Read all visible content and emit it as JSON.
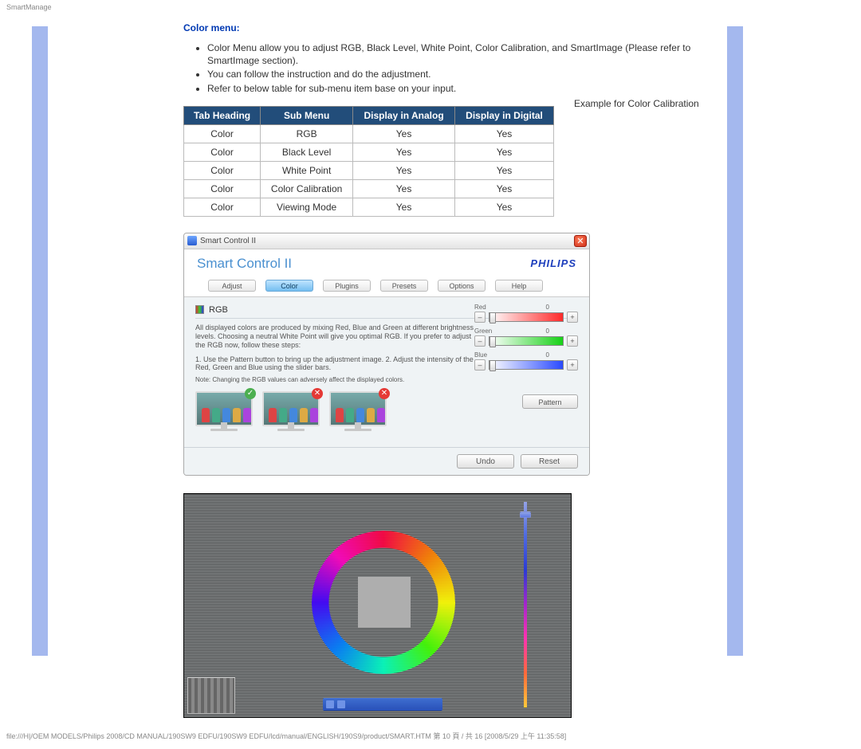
{
  "page_header": "SmartManage",
  "section_title": "Color menu:",
  "bullets": [
    "Color Menu allow you to adjust RGB, Black Level, White Point, Color Calibration, and SmartImage (Please refer to SmartImage section).",
    "You can follow the instruction and do the adjustment.",
    "Refer to below table for sub-menu item base on your input."
  ],
  "example_text": "Example for Color Calibration",
  "table": {
    "headers": [
      "Tab Heading",
      "Sub Menu",
      "Display in Analog",
      "Display in Digital"
    ],
    "rows": [
      [
        "Color",
        "RGB",
        "Yes",
        "Yes"
      ],
      [
        "Color",
        "Black Level",
        "Yes",
        "Yes"
      ],
      [
        "Color",
        "White Point",
        "Yes",
        "Yes"
      ],
      [
        "Color",
        "Color Calibration",
        "Yes",
        "Yes"
      ],
      [
        "Color",
        "Viewing Mode",
        "Yes",
        "Yes"
      ]
    ]
  },
  "window": {
    "title": "Smart Control II",
    "brand_title": "Smart Control II",
    "brand_name": "PHILIPS",
    "tabs": [
      "Adjust",
      "Color",
      "Plugins",
      "Presets",
      "Options",
      "Help"
    ],
    "active_tab": 1,
    "panel_label": "RGB",
    "desc": "All displayed colors are produced by mixing Red, Blue and Green at different brightness levels. Choosing a neutral White Point will give you optimal RGB. If you prefer to adjust the RGB now, follow these steps:",
    "steps": "1. Use the Pattern button to bring up the adjustment image.\n2. Adjust the intensity of the Red, Green and Blue using the slider bars.",
    "note": "Note: Changing the RGB values can adversely affect the displayed colors.",
    "sliders": [
      {
        "label": "Red",
        "value": "0",
        "class": "red"
      },
      {
        "label": "Green",
        "value": "0",
        "class": "green"
      },
      {
        "label": "Blue",
        "value": "0",
        "class": "blue"
      }
    ],
    "pattern_btn": "Pattern",
    "undo_btn": "Undo",
    "reset_btn": "Reset"
  },
  "footer": "file:///H|/OEM MODELS/Philips 2008/CD MANUAL/190SW9 EDFU/190SW9 EDFU/lcd/manual/ENGLISH/190S9/product/SMART.HTM 第 10 頁 / 共 16  [2008/5/29 上午 11:35:58]"
}
